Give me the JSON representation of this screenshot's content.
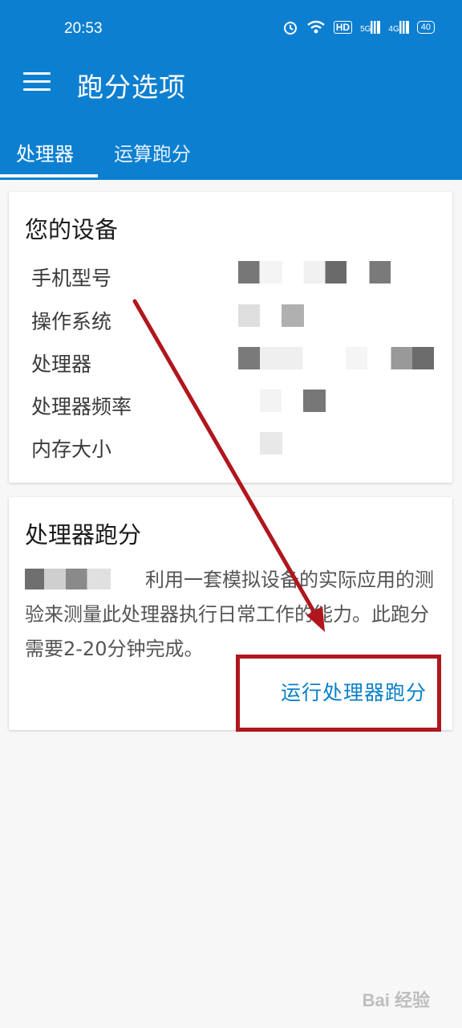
{
  "status_bar": {
    "time": "20:53",
    "hd_label": "HD",
    "net1": "5G",
    "net2": "4G",
    "battery": "40"
  },
  "app_bar": {
    "title": "跑分选项"
  },
  "tabs": [
    {
      "label": "处理器",
      "active": true
    },
    {
      "label": "运算跑分",
      "active": false
    }
  ],
  "device_card": {
    "title": "您的设备",
    "rows": [
      {
        "label": "手机型号",
        "value_redacted": true
      },
      {
        "label": "操作系统",
        "value_redacted": true
      },
      {
        "label": "处理器",
        "value_redacted": true
      },
      {
        "label": "处理器频率",
        "value_redacted": true
      },
      {
        "label": "内存大小",
        "value_redacted": true
      }
    ]
  },
  "benchmark_card": {
    "title": "处理器跑分",
    "description": "利用一套模拟设备的实际应用的测验来测量此处理器执行日常工作的能力。此跑分需要2-20分钟完成。",
    "run_button": "运行处理器跑分"
  },
  "annotation_color": "#b0161c",
  "accent_color": "#0d7fd0",
  "watermark": "Bai 经验"
}
